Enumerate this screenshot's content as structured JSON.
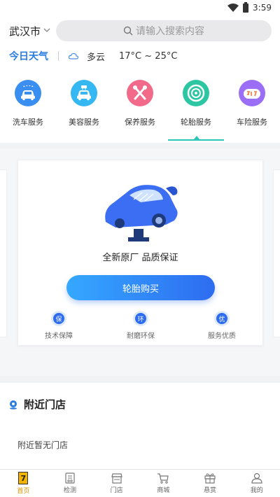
{
  "status_bar": {
    "time": "3:59"
  },
  "header": {
    "city": "武汉市",
    "search_placeholder": "请输入搜索内容"
  },
  "weather": {
    "label": "今日天气",
    "condition": "多云",
    "temperature": "17°C ~ 25°C"
  },
  "services": [
    {
      "label": "洗车服务",
      "icon": "car-wash-icon",
      "color": "#3a8ef0"
    },
    {
      "label": "美容服务",
      "icon": "car-beauty-icon",
      "color": "#35b8f2"
    },
    {
      "label": "保养服务",
      "icon": "maintenance-tools-icon",
      "color": "#f16a8a"
    },
    {
      "label": "轮胎服务",
      "icon": "tire-icon",
      "color": "#2cc6a3"
    },
    {
      "label": "车险服务",
      "icon": "insurance-icon",
      "color": "#9b6ff5"
    }
  ],
  "card": {
    "slogan": "全新原厂 品质保证",
    "button": "轮胎购买",
    "features": [
      {
        "badge": "保",
        "label": "技术保障"
      },
      {
        "badge": "环",
        "label": "耐磨环保"
      },
      {
        "badge": "优",
        "label": "服务优质"
      }
    ]
  },
  "nearby": {
    "title": "附近门店",
    "empty": "附近暂无门店"
  },
  "bottom_nav": [
    {
      "label": "首页",
      "icon": "home-icon",
      "badge": "7"
    },
    {
      "label": "检测",
      "icon": "inspection-icon"
    },
    {
      "label": "门店",
      "icon": "store-icon"
    },
    {
      "label": "商城",
      "icon": "cart-icon"
    },
    {
      "label": "悬赏",
      "icon": "gift-icon"
    },
    {
      "label": "我的",
      "icon": "profile-icon"
    }
  ],
  "colors": {
    "accent": "#2a7ce0",
    "active_tab": "#2ec4b6",
    "nav_active": "#d89400"
  }
}
